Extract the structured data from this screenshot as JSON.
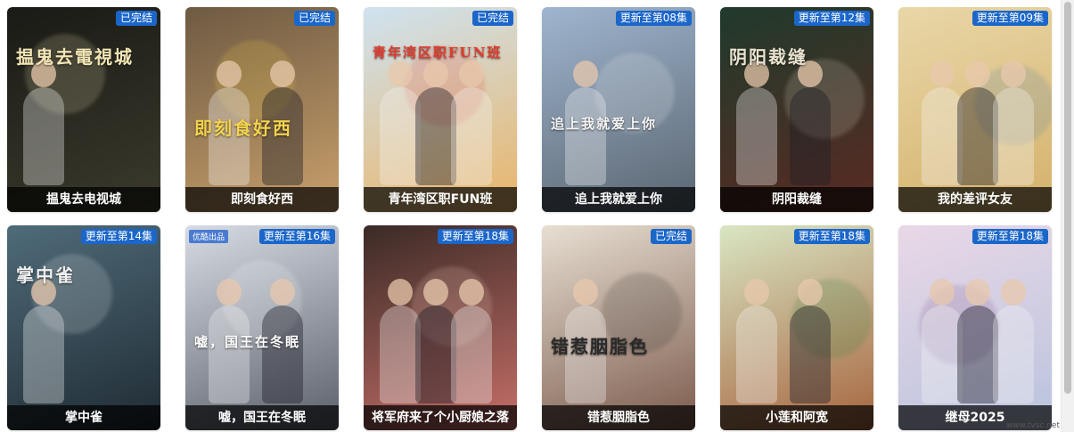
{
  "cards": [
    {
      "title": "揾鬼去电视城",
      "badge": "已完结",
      "art": "揾鬼去電視城",
      "bg": [
        "#1a1a16",
        "#3b3a2c"
      ],
      "accent": "#f2e6b5"
    },
    {
      "title": "即刻食好西",
      "badge": "已完结",
      "art": "即刻食好西",
      "bg": [
        "#6e5a43",
        "#c9a06b"
      ],
      "accent": "#f3d34a"
    },
    {
      "title": "青年湾区职FUN班",
      "badge": "已完结",
      "art": "青年湾区职FUN班",
      "bg": [
        "#cfe3f1",
        "#e9b466"
      ],
      "accent": "#e23a2c"
    },
    {
      "title": "追上我就爱上你",
      "badge": "更新至第08集",
      "art": "追上我就爱上你",
      "bg": [
        "#9fb5cf",
        "#5a6570"
      ],
      "accent": "#f5f5f5"
    },
    {
      "title": "阴阳裁缝",
      "badge": "更新至第12集",
      "art": "阴阳裁缝",
      "bg": [
        "#203a2c",
        "#5a2a22"
      ],
      "accent": "#e9e2cf"
    },
    {
      "title": "我的差评女友",
      "badge": "更新至第09集",
      "art": "",
      "bg": [
        "#e9d7a8",
        "#d4b16a"
      ],
      "accent": "#4a7ba6"
    },
    {
      "title": "掌中雀",
      "badge": "更新至第14集",
      "art": "掌中雀",
      "bg": [
        "#4f6b79",
        "#1f2b33"
      ],
      "accent": "#f0f0f0"
    },
    {
      "title": "嘘，国王在冬眠",
      "badge": "更新至第16集",
      "art": "嘘，国王在冬眠",
      "bg": [
        "#d7dce4",
        "#5a5f6a"
      ],
      "accent": "#ffffff",
      "tag": "优酷出品"
    },
    {
      "title": "将军府来了个小厨娘之落",
      "badge": "更新至第18集",
      "art": "",
      "bg": [
        "#3b2a26",
        "#c76f68"
      ],
      "accent": "#f5d6c8"
    },
    {
      "title": "错惹胭脂色",
      "badge": "已完结",
      "art": "错惹胭脂色",
      "bg": [
        "#e7dfd2",
        "#7b5a4c"
      ],
      "accent": "#2a2a2a"
    },
    {
      "title": "小莲和阿宽",
      "badge": "更新至第18集",
      "art": "",
      "bg": [
        "#d9e6c3",
        "#a6643e"
      ],
      "accent": "#2a7a3a"
    },
    {
      "title": "继母2025",
      "badge": "更新至第18集",
      "art": "",
      "bg": [
        "#e9d8e7",
        "#b9c3de"
      ],
      "accent": "#7a4c8b"
    }
  ],
  "watermark": "www.tvsc.net"
}
